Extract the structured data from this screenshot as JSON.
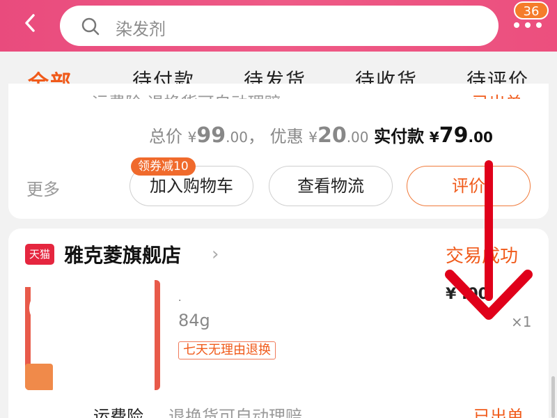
{
  "header": {
    "search_placeholder": "染发剂",
    "cart_badge": "36"
  },
  "tabs": [
    {
      "label": "全部",
      "active": true
    },
    {
      "label": "待付款"
    },
    {
      "label": "待发货"
    },
    {
      "label": "待收货"
    },
    {
      "label": "待评价"
    }
  ],
  "order1": {
    "cut_left": "运费险 退换货可自动理赔",
    "cut_right": "已出单",
    "total_label": "总价",
    "currency": "¥",
    "total_int": "99",
    "total_dec": ".00",
    "comma": "，",
    "discount_label": "优惠",
    "discount_int": "20",
    "discount_dec": ".00",
    "paid_label": "实付款",
    "paid_int": "79",
    "paid_dec": ".00",
    "more_label": "更多",
    "coupon": "领券减10",
    "btn_cart": "加入购物车",
    "btn_logistics": "查看物流",
    "btn_review": "评价"
  },
  "order2": {
    "store_badge": "天猫",
    "store_name": "雅克菱旗舰店",
    "status": "交易成功",
    "weight": "84g",
    "tag": "七天无理由退换",
    "qty": "×1",
    "price_partial": "¥    .00",
    "insurance_label": "运费险",
    "insurance_text": "退换货可自动理赔",
    "shipped": "已出单"
  },
  "colors": {
    "header": "#ec4f7e",
    "accent": "#f05a1a",
    "arrow": "#e0001a"
  }
}
